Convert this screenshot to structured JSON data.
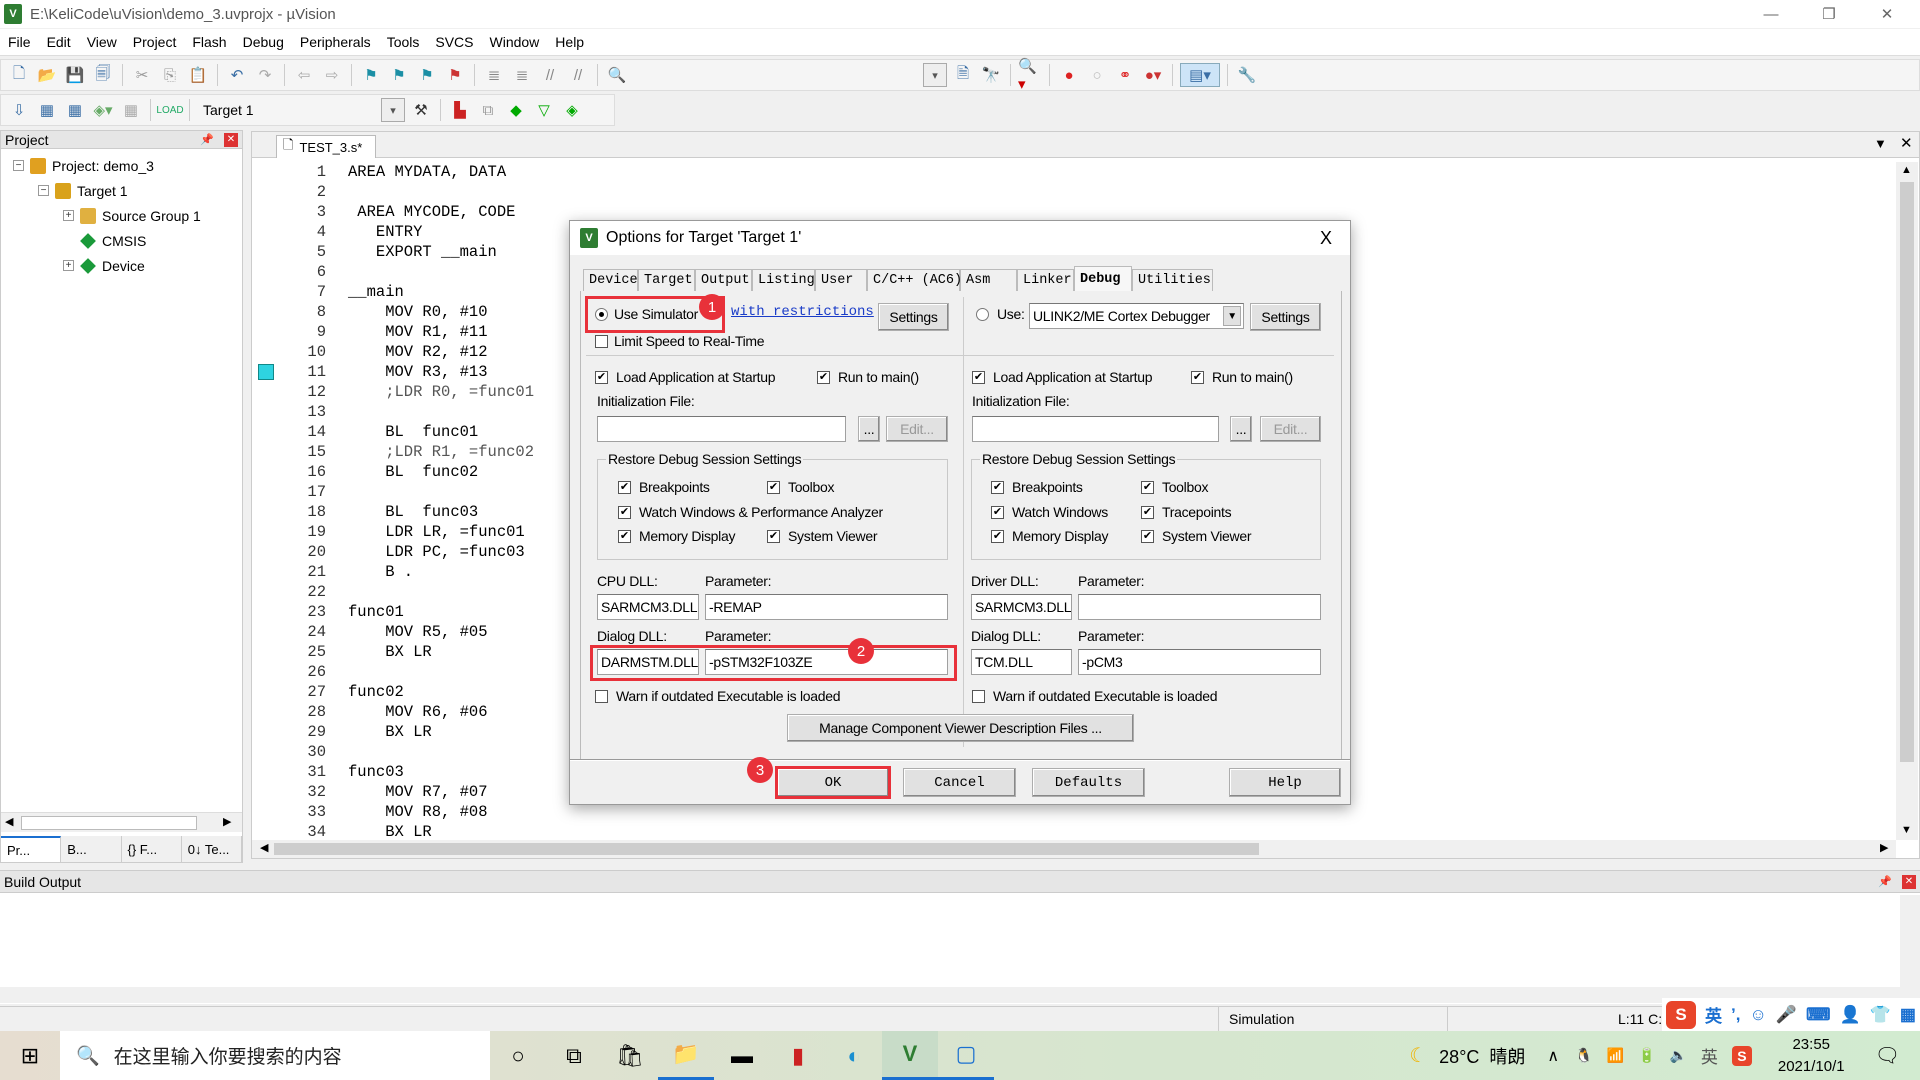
{
  "window": {
    "title": "E:\\KeliCode\\uVision\\demo_3.uvprojx - µVision",
    "icon": "keil-uv-icon"
  },
  "menu": [
    "File",
    "Edit",
    "View",
    "Project",
    "Flash",
    "Debug",
    "Peripherals",
    "Tools",
    "SVCS",
    "Window",
    "Help"
  ],
  "toolbar2": {
    "target_select": "Target 1"
  },
  "project_panel": {
    "title": "Project",
    "tree": [
      {
        "label": "Project: demo_3",
        "level": 0,
        "expander": "−"
      },
      {
        "label": "Target 1",
        "level": 1,
        "expander": "−"
      },
      {
        "label": "Source Group 1",
        "level": 2,
        "expander": "+"
      },
      {
        "label": "CMSIS",
        "level": 2,
        "expander": ""
      },
      {
        "label": "Device",
        "level": 2,
        "expander": "+"
      }
    ],
    "bottom_tabs": [
      "Pr...",
      "B...",
      "{} F...",
      "0↓ Te..."
    ]
  },
  "editor": {
    "tab": "TEST_3.s*",
    "bookmark_line": 11,
    "lines": [
      "AREA MYDATA, DATA",
      "",
      " AREA MYCODE, CODE",
      "   ENTRY",
      "   EXPORT __main",
      "",
      "__main",
      "    MOV R0, #10",
      "    MOV R1, #11",
      "    MOV R2, #12",
      "    MOV R3, #13",
      "    ;LDR R0, =func01",
      "",
      "    BL  func01",
      "    ;LDR R1, =func02",
      "    BL  func02",
      "",
      "    BL  func03",
      "    LDR LR, =func01",
      "    LDR PC, =func03",
      "    B .",
      "",
      "func01",
      "    MOV R5, #05",
      "    BX LR",
      "",
      "func02",
      "    MOV R6, #06",
      "    BX LR",
      "",
      "func03",
      "    MOV R7, #07",
      "    MOV R8, #08",
      "    BX LR"
    ]
  },
  "build_output": {
    "title": "Build Output"
  },
  "status_bar": {
    "mode": "Simulation",
    "position": "L:11 C:"
  },
  "ime_bar": {
    "lang": "英",
    "punct": "ʼ,"
  },
  "dialog": {
    "title": "Options for Target 'Target 1'",
    "close": "X",
    "tabs": [
      "Device",
      "Target",
      "Output",
      "Listing",
      "User",
      "C/C++ (AC6)",
      "Asm",
      "Linker",
      "Debug",
      "Utilities"
    ],
    "active_tab": "Debug",
    "left": {
      "use_simulator": "Use Simulator",
      "use_simulator_selected": true,
      "restrictions_link": "with restrictions",
      "settings": "Settings",
      "limit_speed": "Limit Speed to Real-Time",
      "limit_speed_checked": false,
      "load_app": "Load Application at Startup",
      "run_to_main": "Run to main()",
      "init_file_label": "Initialization File:",
      "init_file_value": "",
      "browse": "...",
      "edit": "Edit...",
      "restore_group": "Restore Debug Session Settings",
      "restore": [
        "Breakpoints",
        "Toolbox",
        "Watch Windows & Performance Analyzer",
        "Memory Display",
        "System Viewer"
      ],
      "cpu_dll_label": "CPU DLL:",
      "cpu_dll": "SARMCM3.DLL",
      "param_label": "Parameter:",
      "cpu_param": "-REMAP",
      "dialog_dll_label": "Dialog DLL:",
      "dialog_dll": "DARMSTM.DLL",
      "dialog_param": "-pSTM32F103ZE",
      "warn": "Warn if outdated Executable is loaded"
    },
    "right": {
      "use": "Use:",
      "use_selected": false,
      "debugger": "ULINK2/ME Cortex Debugger",
      "settings": "Settings",
      "load_app": "Load Application at Startup",
      "run_to_main": "Run to main()",
      "init_file_label": "Initialization File:",
      "init_file_value": "",
      "browse": "...",
      "edit": "Edit...",
      "restore_group": "Restore Debug Session Settings",
      "restore": [
        "Breakpoints",
        "Toolbox",
        "Watch Windows",
        "Tracepoints",
        "Memory Display",
        "System Viewer"
      ],
      "driver_dll_label": "Driver DLL:",
      "driver_dll": "SARMCM3.DLL",
      "param_label": "Parameter:",
      "driver_param": "",
      "dialog_dll_label": "Dialog DLL:",
      "dialog_dll": "TCM.DLL",
      "dialog_param": "-pCM3",
      "warn": "Warn if outdated Executable is loaded"
    },
    "manage_button": "Manage Component Viewer Description Files ...",
    "buttons": {
      "ok": "OK",
      "cancel": "Cancel",
      "defaults": "Defaults",
      "help": "Help"
    }
  },
  "annotations": {
    "color": "#e8313a",
    "badges": [
      "1",
      "2",
      "3"
    ]
  },
  "taskbar": {
    "search_placeholder": "在这里输入你要搜索的内容",
    "weather": "28°C  晴朗",
    "ime": "英",
    "time": "23:55",
    "date": "2021/10/1"
  }
}
